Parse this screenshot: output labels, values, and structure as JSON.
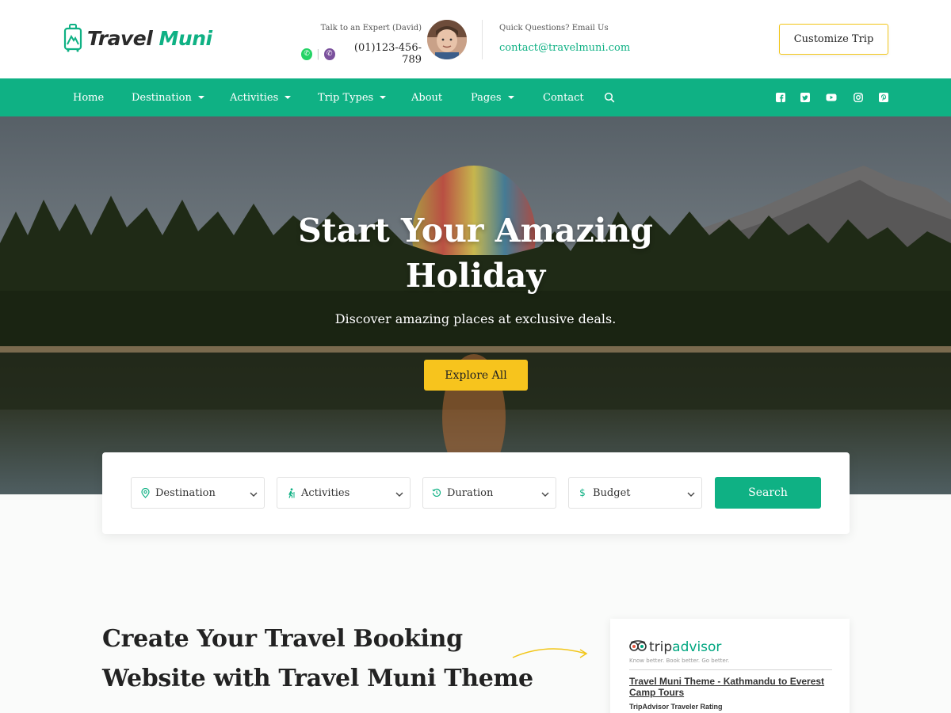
{
  "header": {
    "logo": {
      "word1": "Travel",
      "word2": "Muni",
      "icon": "suitcase-logo-icon"
    },
    "expert": {
      "label": "Talk to an Expert (David)",
      "phone": "(01)123-456-789",
      "icons": [
        "whatsapp-icon",
        "viber-icon"
      ]
    },
    "quick": {
      "label": "Quick Questions? Email Us",
      "email": "contact@travelmuni.com"
    },
    "customize_label": "Customize Trip"
  },
  "nav": {
    "items": [
      {
        "label": "Home",
        "dropdown": false
      },
      {
        "label": "Destination",
        "dropdown": true
      },
      {
        "label": "Activities",
        "dropdown": true
      },
      {
        "label": "Trip Types",
        "dropdown": true
      },
      {
        "label": "About",
        "dropdown": false
      },
      {
        "label": "Pages",
        "dropdown": true
      },
      {
        "label": "Contact",
        "dropdown": false
      }
    ],
    "social": [
      "facebook-icon",
      "twitter-icon",
      "youtube-icon",
      "instagram-icon",
      "pinterest-icon"
    ]
  },
  "hero": {
    "title_line1": "Start Your Amazing",
    "title_line2": "Holiday",
    "subtitle": "Discover amazing places at exclusive deals.",
    "cta_label": "Explore All"
  },
  "search": {
    "fields": [
      {
        "label": "Destination",
        "icon": "map-pin-icon"
      },
      {
        "label": "Activities",
        "icon": "hiking-icon"
      },
      {
        "label": "Duration",
        "icon": "history-icon"
      },
      {
        "label": "Budget",
        "icon": "dollar-icon"
      }
    ],
    "button_label": "Search"
  },
  "promo": {
    "title_line1": "Create Your Travel Booking",
    "title_line2": "Website with Travel Muni Theme"
  },
  "tripadvisor": {
    "logo_part1": "trip",
    "logo_part2": "advisor",
    "tagline": "Know better. Book better. Go better.",
    "link_text": "Travel Muni Theme - Kathmandu to Everest Camp Tours",
    "rating_label": "TripAdvisor Traveler Rating"
  },
  "colors": {
    "brand": "#0fb184",
    "accent": "#f7c41d"
  }
}
